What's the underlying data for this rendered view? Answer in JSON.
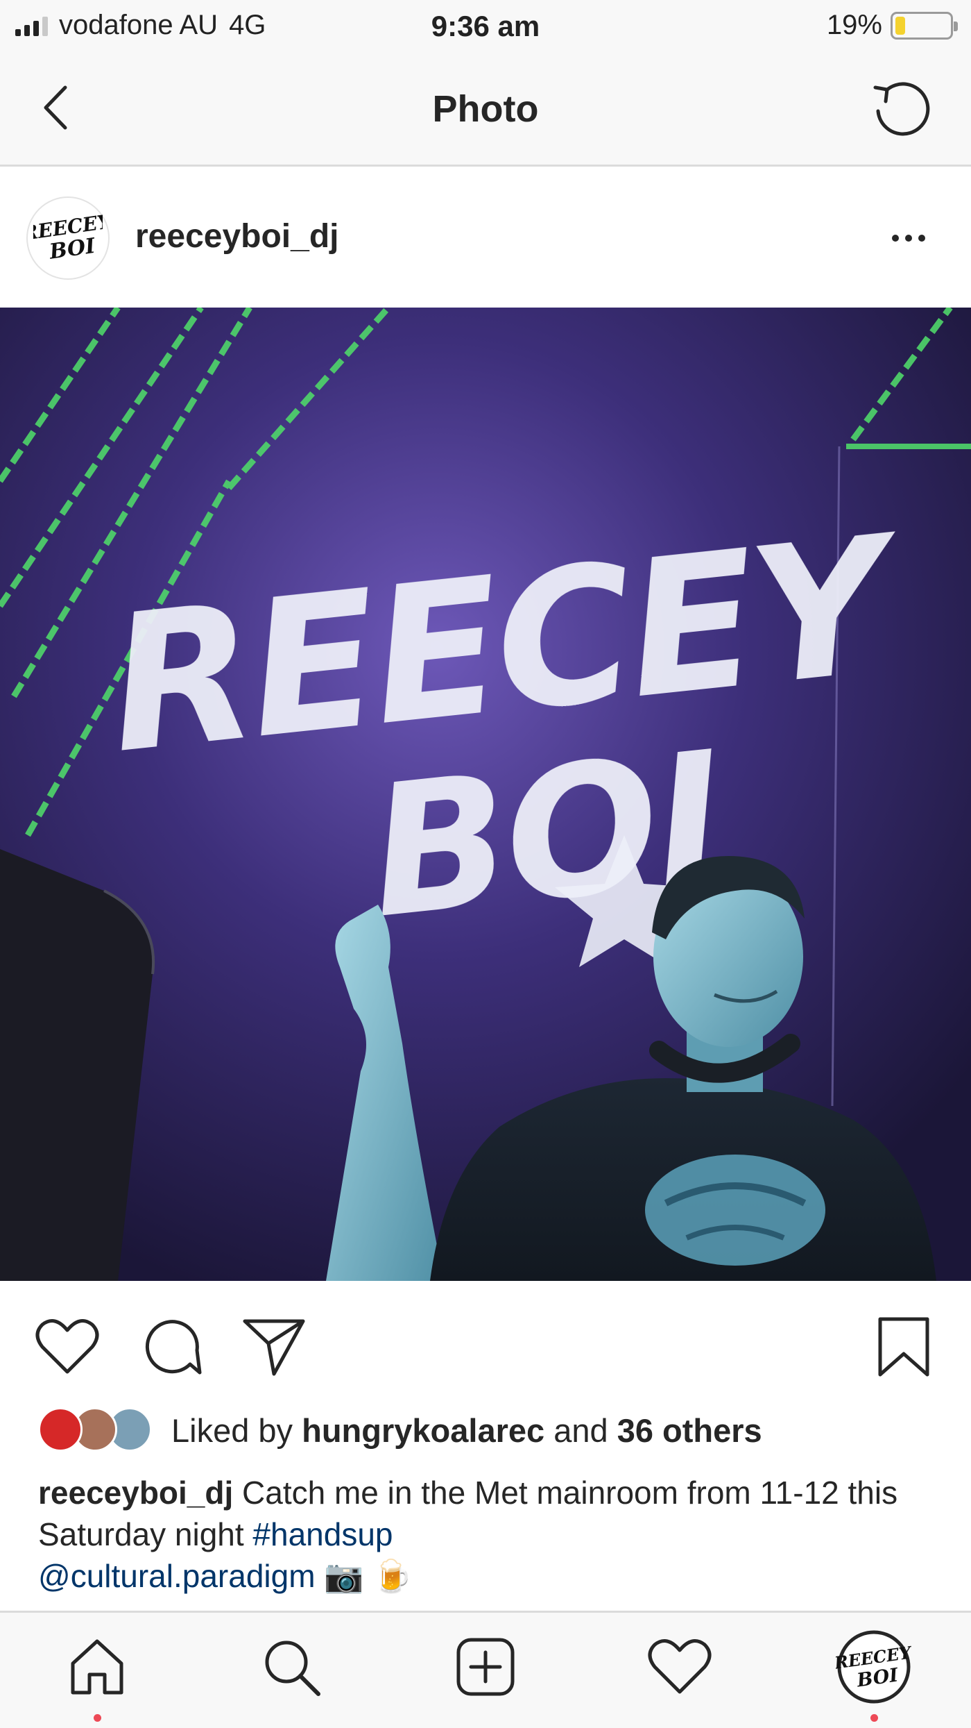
{
  "status_bar": {
    "carrier": "vodafone AU",
    "network": "4G",
    "time": "9:36 am",
    "battery_percent_label": "19%",
    "battery_level": 0.19,
    "battery_color": "#f4d22f"
  },
  "header": {
    "title": "Photo",
    "back_icon": "chevron-left-icon",
    "refresh_icon": "refresh-icon"
  },
  "post": {
    "username": "reeceyboi_dj",
    "more_icon": "ellipsis-icon",
    "photo": {
      "logo_text_line1": "REECEY",
      "logo_text_line2": "BOI",
      "background_color": "#2e2656",
      "laser_color": "#4fd66a"
    },
    "actions": {
      "like_icon": "heart-icon",
      "comment_icon": "comment-icon",
      "share_icon": "paper-plane-icon",
      "save_icon": "bookmark-icon"
    },
    "likes": {
      "prefix": "Liked by ",
      "top_liker": "hungrykoalarec",
      "middle": " and ",
      "others": "36 others"
    },
    "caption": {
      "username": "reeceyboi_dj",
      "text_part1": " Catch me in the Met mainroom from 11-12 this Saturday night ",
      "hashtag": "#handsup",
      "mention": "@cultural.paradigm",
      "emoji": "📷 🍺"
    }
  },
  "tab_bar": {
    "items": [
      {
        "icon": "home-icon",
        "active_dot": true
      },
      {
        "icon": "search-icon",
        "active_dot": false
      },
      {
        "icon": "add-post-icon",
        "active_dot": false
      },
      {
        "icon": "heart-icon",
        "active_dot": false
      },
      {
        "icon": "profile-avatar-icon",
        "active_dot": true
      }
    ]
  },
  "colors": {
    "text": "#262626",
    "link": "#003569",
    "notification_dot": "#ed4956",
    "divider": "#dbdbdb"
  }
}
